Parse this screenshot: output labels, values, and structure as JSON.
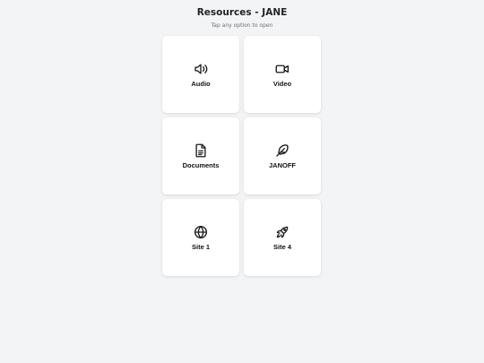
{
  "header": {
    "title": "Resources - JANE",
    "subtitle": "Tap any option to open"
  },
  "cards": [
    {
      "label": "Audio",
      "icon": "speaker-icon"
    },
    {
      "label": "Video",
      "icon": "video-camera-icon"
    },
    {
      "label": "Documents",
      "icon": "document-icon"
    },
    {
      "label": "JANOFF",
      "icon": "feather-icon"
    },
    {
      "label": "Site 1",
      "icon": "globe-icon"
    },
    {
      "label": "Site 4",
      "icon": "rocket-icon"
    }
  ],
  "colors": {
    "background": "#f3f4f6",
    "card": "#ffffff",
    "text": "#111111",
    "muted": "#6b6f76"
  }
}
